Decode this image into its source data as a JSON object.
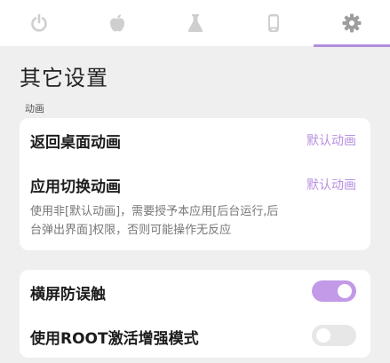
{
  "tabs": [
    {
      "icon": "power-icon",
      "active": false
    },
    {
      "icon": "apple-icon",
      "active": false
    },
    {
      "icon": "flask-icon",
      "active": false
    },
    {
      "icon": "phone-icon",
      "active": false
    },
    {
      "icon": "gear-icon",
      "active": true
    }
  ],
  "colors": {
    "accent": "#b48de0",
    "background": "#efefef",
    "card": "#ffffff",
    "icon_inactive": "#cfcfcf",
    "icon_active": "#9e9e9e"
  },
  "page": {
    "title": "其它设置"
  },
  "animation_section": {
    "label": "动画",
    "back_home": {
      "title": "返回桌面动画",
      "value": "默认动画"
    },
    "app_switch": {
      "title": "应用切换动画",
      "value": "默认动画",
      "desc_line1": "使用非[默认动画]，需要授予本应用[后台运行,后",
      "desc_line2": "台弹出界面]权限，否则可能操作无反应"
    }
  },
  "misc_section": {
    "landscape_guard": {
      "title": "横屏防误触",
      "enabled": true
    },
    "root_mode": {
      "title": "使用ROOT激活增强模式",
      "enabled": false
    }
  }
}
